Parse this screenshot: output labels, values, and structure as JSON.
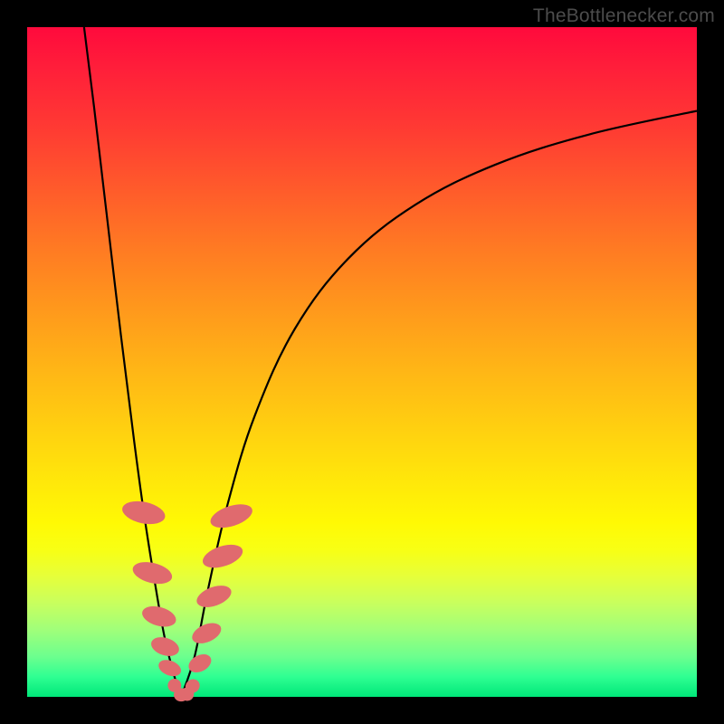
{
  "watermark": {
    "text": "TheBottlenecker.com"
  },
  "colors": {
    "frame_bg": "#000000",
    "curve": "#000000",
    "bead": "#e06a6e",
    "watermark": "#4c4c4c"
  },
  "chart_data": {
    "type": "line",
    "title": "",
    "xlabel": "",
    "ylabel": "",
    "xlim": [
      0,
      100
    ],
    "ylim": [
      0,
      100
    ],
    "series": [
      {
        "name": "left-branch",
        "x": [
          8.5,
          10,
          12,
          14,
          16,
          17.5,
          19,
          20.5,
          22,
          23
        ],
        "y": [
          100,
          88,
          71,
          54,
          38,
          27,
          17.5,
          9,
          3,
          0
        ]
      },
      {
        "name": "right-branch",
        "x": [
          23,
          25,
          27,
          30,
          34,
          40,
          48,
          58,
          70,
          84,
          100
        ],
        "y": [
          0,
          6,
          16,
          29,
          42,
          55,
          65.5,
          73.5,
          79.5,
          84,
          87.5
        ]
      }
    ],
    "markers": [
      {
        "branch": "left",
        "x": 17.4,
        "y": 27.5,
        "w": 3.2,
        "h": 6.5,
        "angle": -78
      },
      {
        "branch": "left",
        "x": 18.7,
        "y": 18.5,
        "w": 3.0,
        "h": 6.0,
        "angle": -76
      },
      {
        "branch": "left",
        "x": 19.7,
        "y": 12.0,
        "w": 2.8,
        "h": 5.2,
        "angle": -74
      },
      {
        "branch": "left",
        "x": 20.6,
        "y": 7.5,
        "w": 2.6,
        "h": 4.3,
        "angle": -72
      },
      {
        "branch": "left",
        "x": 21.3,
        "y": 4.3,
        "w": 2.2,
        "h": 3.5,
        "angle": -68
      },
      {
        "branch": "bottom",
        "x": 22.0,
        "y": 1.7,
        "w": 2.0,
        "h": 2.0,
        "angle": 0
      },
      {
        "branch": "bottom",
        "x": 23.0,
        "y": 0.3,
        "w": 2.2,
        "h": 2.0,
        "angle": 0
      },
      {
        "branch": "bottom",
        "x": 23.9,
        "y": 0.4,
        "w": 2.0,
        "h": 2.0,
        "angle": 0
      },
      {
        "branch": "bottom",
        "x": 24.7,
        "y": 1.6,
        "w": 2.0,
        "h": 2.2,
        "angle": 55
      },
      {
        "branch": "right",
        "x": 25.8,
        "y": 5.0,
        "w": 2.4,
        "h": 3.6,
        "angle": 62
      },
      {
        "branch": "right",
        "x": 26.8,
        "y": 9.5,
        "w": 2.6,
        "h": 4.6,
        "angle": 66
      },
      {
        "branch": "right",
        "x": 27.9,
        "y": 15.0,
        "w": 2.8,
        "h": 5.4,
        "angle": 70
      },
      {
        "branch": "right",
        "x": 29.2,
        "y": 21.0,
        "w": 3.0,
        "h": 6.2,
        "angle": 72
      },
      {
        "branch": "right",
        "x": 30.5,
        "y": 27.0,
        "w": 3.0,
        "h": 6.5,
        "angle": 72
      }
    ]
  }
}
